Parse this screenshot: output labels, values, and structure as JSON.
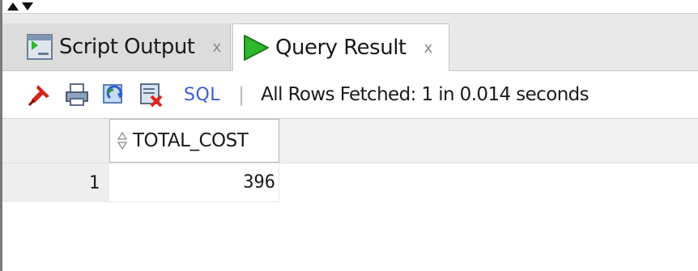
{
  "tabs": [
    {
      "label": "Script Output",
      "close": "x",
      "icon": "script-output-icon",
      "active": false
    },
    {
      "label": "Query Result",
      "close": "x",
      "icon": "run-triangle-icon",
      "active": true
    }
  ],
  "toolbar": {
    "icons": [
      "pin-icon",
      "print-icon",
      "refresh-icon",
      "export-icon"
    ],
    "sql_label": "SQL",
    "separator": "|",
    "status": "All Rows Fetched: 1 in 0.014 seconds"
  },
  "grid": {
    "columns": [
      {
        "name": "TOTAL_COST"
      }
    ],
    "rows": [
      {
        "num": "1",
        "values": [
          "396"
        ]
      }
    ]
  },
  "colors": {
    "sql_link": "#3a5fcd",
    "run_icon": "#2db82d"
  }
}
